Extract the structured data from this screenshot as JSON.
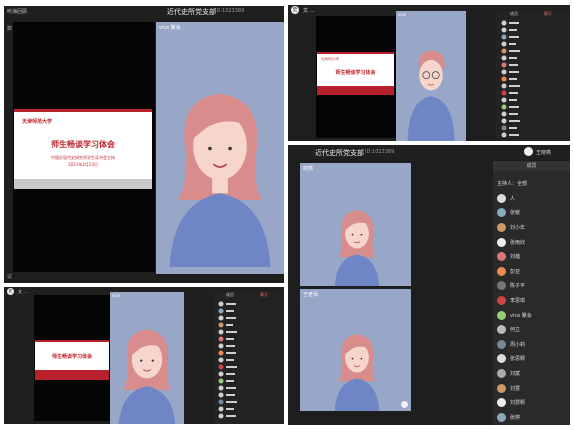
{
  "panel_a": {
    "top_left": "听海回顾",
    "title": "近代史所党支部",
    "meeting_id": "ID:1023389",
    "left_label": "数：",
    "video_label": "vice 聚会",
    "bottom_left": "议"
  },
  "panel_b": {
    "avatar_initial": "史",
    "user_name": "文 …",
    "video_label": "vice",
    "tab_1": "成员",
    "tab_2": "聊天"
  },
  "panel_c": {
    "title": "近代史所党支部",
    "meeting_id": "ID:1023389",
    "user_name": "王晓燕",
    "members_header": "成员",
    "all_mute": "全部",
    "host_label": "主持人：",
    "video_1_label": "晓燕",
    "video_2_label": "王老师"
  },
  "panel_d": {
    "avatar_initial": "史",
    "user_name": "文 …",
    "video_label": "vice",
    "tab_1": "成员",
    "tab_2": "聊天"
  },
  "slide": {
    "logo_text": "天津师范大学",
    "title": "师生畅谈学习体会",
    "subtitle": "中国近现代史研究所学生读书会主持",
    "date": "2021年2月23日"
  },
  "participants_c": [
    "主讲人",
    "人",
    "张敏",
    "刘小年",
    "张雨欣",
    "刘蓓",
    "彭亚",
    "陈子平",
    "李思琪",
    "vice 聚会",
    "何立",
    "周小莉",
    "张思颖",
    "刘斌",
    "刘慧",
    "刘慧颖",
    "张婷"
  ],
  "colors": {
    "dark_bg": "#1e1e1e",
    "video_bg": "#98a6c7",
    "slide_red": "#b8212b",
    "hair": "#d98c8c",
    "skin": "#f6d6cc",
    "sweater": "#6f86c6"
  }
}
